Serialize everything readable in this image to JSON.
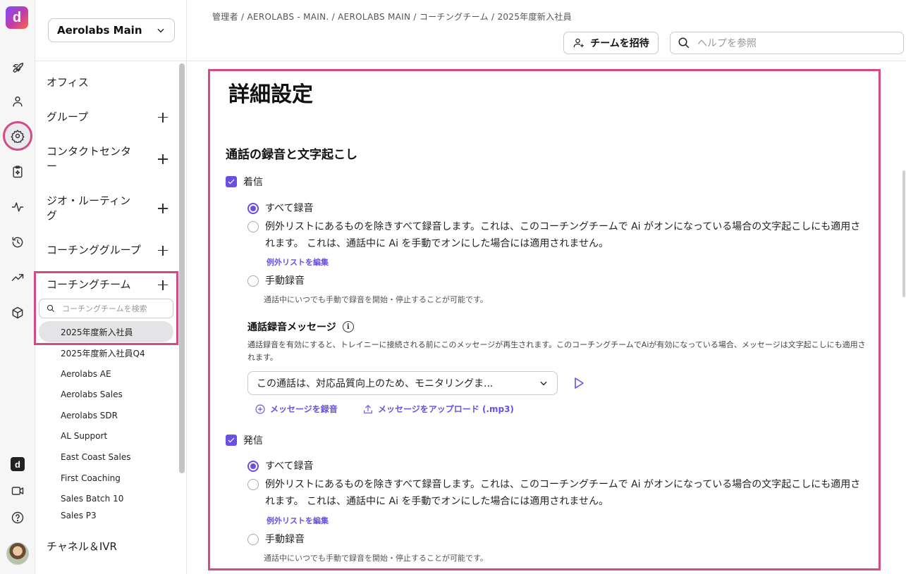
{
  "rail": {
    "logo_letter": "d",
    "icons": [
      "rocket-icon",
      "person-icon",
      "gear-icon",
      "clipboard-icon",
      "activity-icon",
      "history-icon",
      "trending-icon",
      "cube-icon",
      "dialpad-icon",
      "video-icon",
      "help-icon"
    ]
  },
  "sidebar": {
    "org_name": "Aerolabs Main",
    "nav": [
      {
        "label": "オフィス"
      },
      {
        "label": "グループ"
      },
      {
        "label": "コンタクトセンター"
      },
      {
        "label": "ジオ・ルーティング"
      },
      {
        "label": "コーチンググループ"
      },
      {
        "label": "コーチングチーム"
      }
    ],
    "team_search_placeholder": "コーチングチームを検索",
    "teams": [
      "2025年度新入社員",
      "2025年度新入社員Q4",
      "Aerolabs AE",
      "Aerolabs Sales",
      "Aerolabs SDR",
      "AL Support",
      "East Coast Sales",
      "First Coaching",
      "Sales Batch 10",
      "Sales P3"
    ],
    "bottom_item": "チャネル＆IVR"
  },
  "header": {
    "breadcrumb": "管理者 / AEROLABS - MAIN. / AEROLABS MAIN / コーチングチーム / 2025年度新入社員",
    "invite_label": "チームを招待",
    "help_placeholder": "ヘルプを参照"
  },
  "main": {
    "title": "詳細設定",
    "section_title": "通話の録音と文字起こし",
    "incoming": {
      "label": "着信",
      "options": [
        {
          "label": "すべて録音",
          "selected": true
        },
        {
          "label": "例外リストにあるものを除きすべて録音します。これは、このコーチングチームで Ai がオンになっている場合の文字起こしにも適用されます。 これは、通話中に Ai を手動でオンにした場合には適用されません。",
          "selected": false
        },
        {
          "label": "手動録音",
          "selected": false
        }
      ],
      "edit_exceptions": "例外リストを編集",
      "manual_hint": "通話中にいつでも手動で録音を開始・停止することが可能です。"
    },
    "recording_message": {
      "title": "通話録音メッセージ",
      "info_glyph": "i",
      "description": "通話録音を有効にすると、トレイニーに接続される前にこのメッセージが再生されます。このコーチングチームでAiが有効になっている場合、メッセージは文字起こしにも適用されます。",
      "selected_message": "この通話は、対応品質向上のため、モニタリングま...",
      "record_label": "メッセージを録音",
      "upload_label": "メッセージをアップロード (.mp3)"
    },
    "outgoing": {
      "label": "発信",
      "options": [
        {
          "label": "すべて録音",
          "selected": true
        },
        {
          "label": "例外リストにあるものを除きすべて録音します。これは、このコーチングチームで Ai がオンになっている場合の文字起こしにも適用されます。 これは、通話中に Ai を手動でオンにした場合には適用されません。",
          "selected": false
        },
        {
          "label": "手動録音",
          "selected": false
        }
      ],
      "edit_exceptions": "例外リストを編集",
      "manual_hint": "通話中にいつでも手動で録音を開始・停止することが可能です。"
    }
  },
  "colors": {
    "accent": "#6b4fe0",
    "highlight": "#d24b87"
  }
}
